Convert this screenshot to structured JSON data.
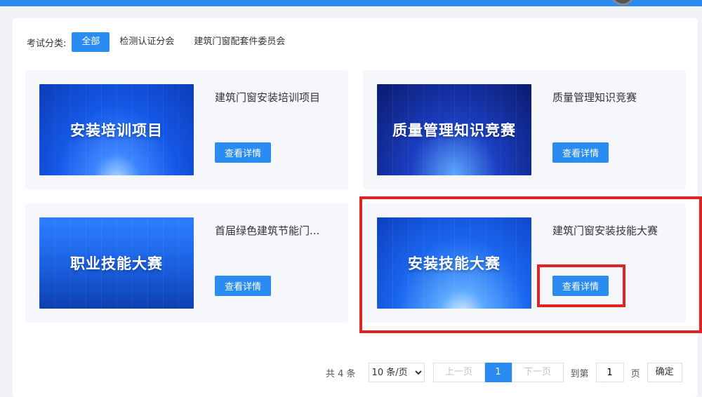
{
  "filter": {
    "label": "考试分类:",
    "options": [
      {
        "label": "全部",
        "active": true
      },
      {
        "label": "检测认证分会",
        "active": false
      },
      {
        "label": "建筑门窗配套件委员会",
        "active": false
      }
    ]
  },
  "cards": [
    {
      "thumb_text": "安装培训项目",
      "title": "建筑门窗安装培训项目",
      "button": "查看详情"
    },
    {
      "thumb_text": "质量管理知识竞赛",
      "title": "质量管理知识竞赛",
      "button": "查看详情"
    },
    {
      "thumb_text": "职业技能大赛",
      "title": "首届绿色建筑节能门...",
      "button": "查看详情"
    },
    {
      "thumb_text": "安装技能大赛",
      "title": "建筑门窗安装技能大赛",
      "button": "查看详情"
    }
  ],
  "pagination": {
    "total": "共 4 条",
    "page_size": "10 条/页",
    "prev": "上一页",
    "current": "1",
    "next": "下一页",
    "goto_prefix": "到第",
    "goto_value": "1",
    "goto_suffix": "页",
    "confirm": "确定"
  },
  "colors": {
    "accent": "#2a8cf0",
    "highlight": "#e02424"
  }
}
